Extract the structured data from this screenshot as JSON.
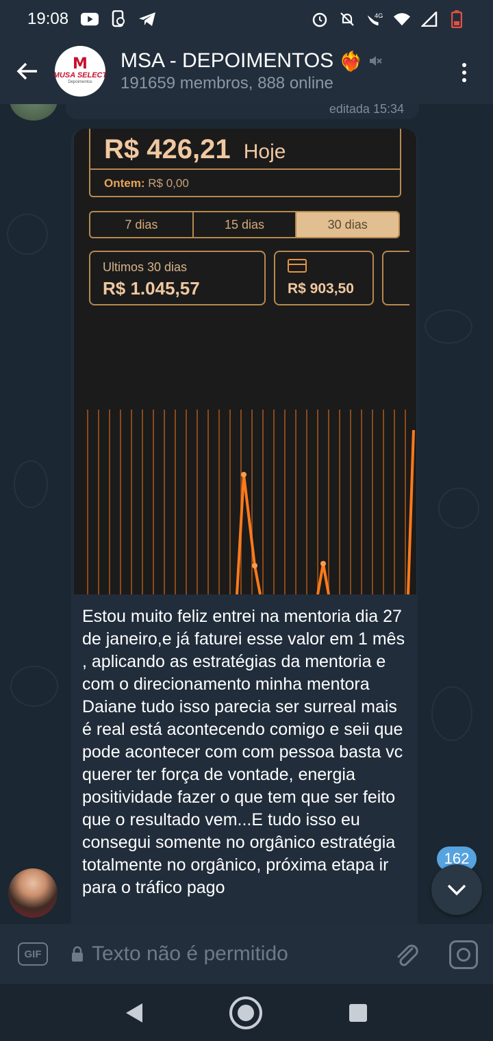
{
  "status_bar": {
    "time": "19:08",
    "left_icons": [
      "youtube-icon",
      "phone-sync-icon",
      "telegram-icon"
    ],
    "right_icons": [
      "alarm-icon",
      "notifications-off-icon",
      "volte-4g-icon",
      "wifi-icon",
      "signal-icon",
      "battery-low-icon"
    ],
    "network_label": "4G"
  },
  "header": {
    "title": "MSA - DEPOIMENTOS",
    "title_emoji": "❤️‍🔥",
    "subtitle": "191659 membros, 888 online",
    "muted_icon": "muted-speaker-icon",
    "avatar": {
      "logo_text": "MUSA SELECT",
      "logo_sub": "Depoimentos"
    }
  },
  "previous_message": {
    "edited_label": "editada 15:34"
  },
  "message": {
    "media": {
      "today_amount": "R$ 426,21",
      "today_label": "Hoje",
      "yesterday_label": "Ontem:",
      "yesterday_amount": "R$ 0,00",
      "tabs": [
        "7 dias",
        "15 dias",
        "30 dias"
      ],
      "selected_tab": "30 dias",
      "card1_label": "Ultimos 30 dias",
      "card1_value": "R$ 1.045,57",
      "card2_value": "R$ 903,50",
      "card2_icon": "credit-card-icon"
    },
    "caption": "Estou muito feliz entrei na mentoria dia 27 de janeiro,e já faturei esse valor em 1 mês , aplicando as estratégias da mentoria e com o direcionamento minha mentora Daiane tudo isso parecia ser surreal mais é real está acontecendo comigo e seii que pode acontecer com com pessoa basta vc querer ter força de vontade, energia positividade fazer o que tem que ser feito que o resultado vem...E tudo isso eu consegui somente no orgânico estratégia totalmente no orgânico, próxima etapa ir para o tráfico pago"
  },
  "unread_count": "162",
  "input_bar": {
    "gif_label": "GIF",
    "placeholder": "Texto não é permitido"
  },
  "colors": {
    "accent": "#57a3e0",
    "chart_line": "#ff7a1a",
    "gold": "#b7894f"
  }
}
